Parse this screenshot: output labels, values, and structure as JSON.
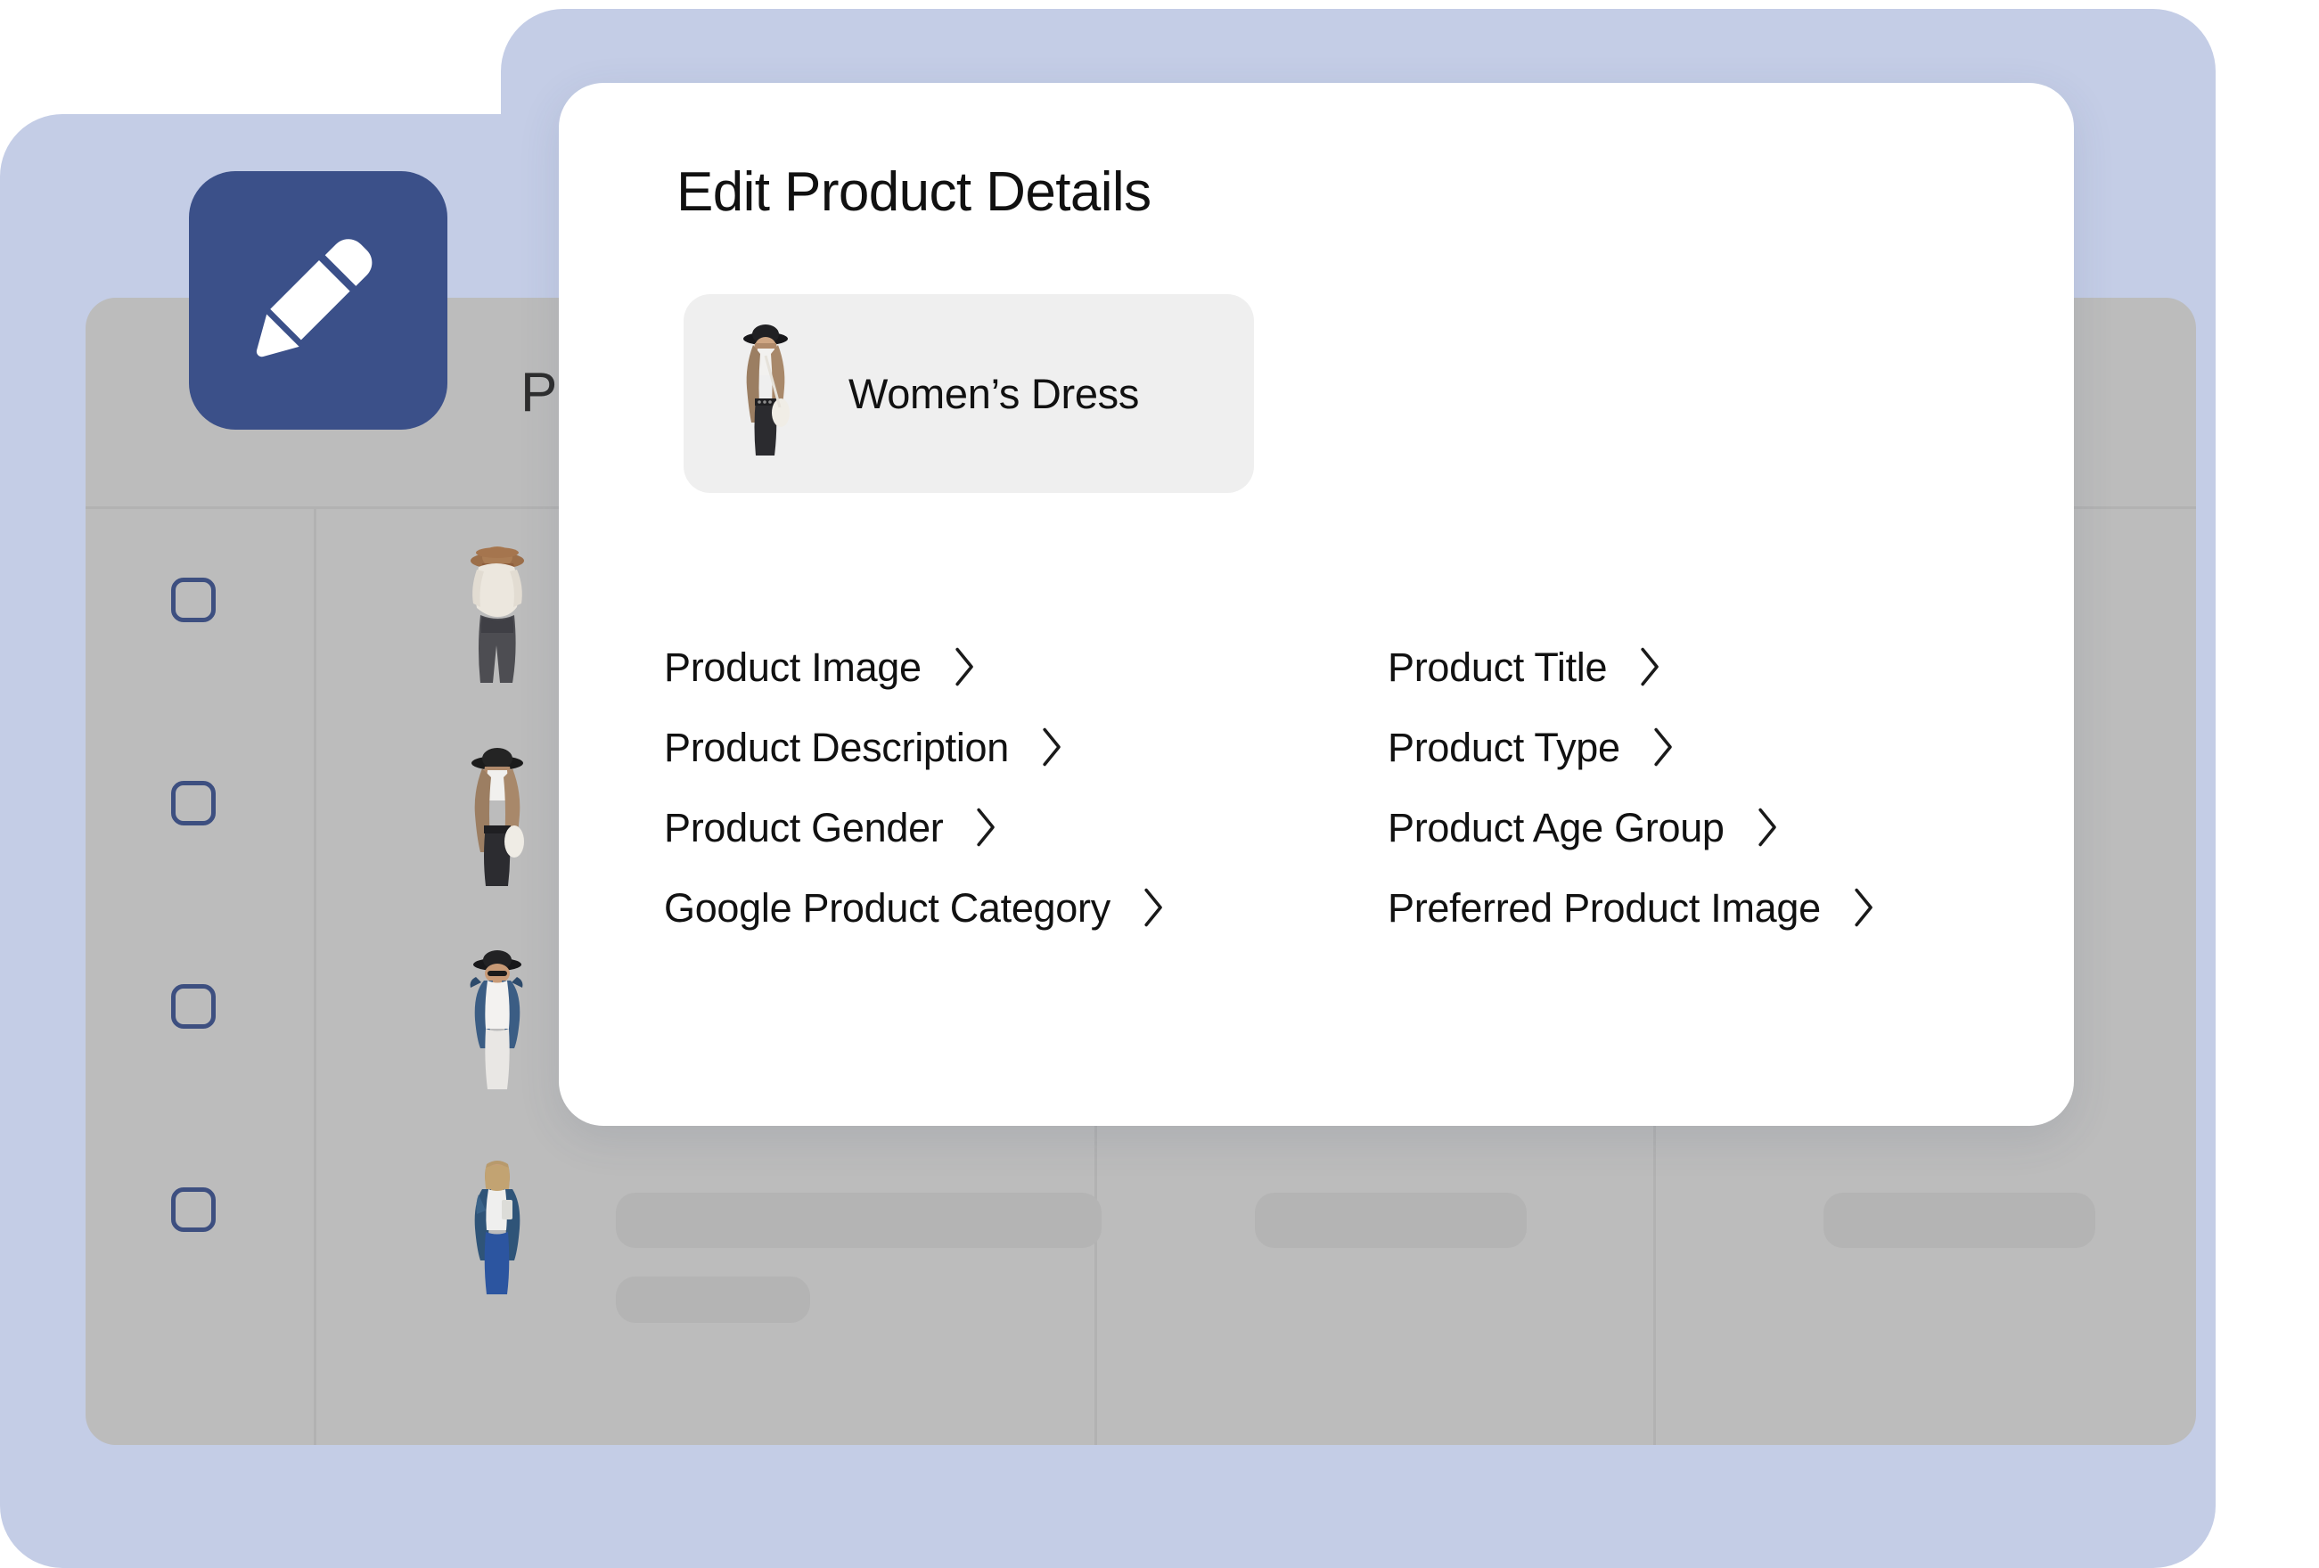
{
  "background": {
    "table_header_label": "P",
    "rows": [
      {
        "checkbox_checked": false
      },
      {
        "checkbox_checked": false
      },
      {
        "checkbox_checked": false
      },
      {
        "checkbox_checked": false
      }
    ]
  },
  "edit_badge": {
    "icon": "pencil-icon"
  },
  "modal": {
    "title": "Edit Product Details",
    "product": {
      "name": "Women’s Dress",
      "thumbnail": "women-dress-thumbnail"
    },
    "fields": [
      {
        "label": "Product Image",
        "chevron": "chevron-right-icon"
      },
      {
        "label": "Product Title",
        "chevron": "chevron-right-icon"
      },
      {
        "label": "Product Description",
        "chevron": "chevron-right-icon"
      },
      {
        "label": "Product Type",
        "chevron": "chevron-right-icon"
      },
      {
        "label": "Product Gender",
        "chevron": "chevron-right-icon"
      },
      {
        "label": "Product Age Group",
        "chevron": "chevron-right-icon"
      },
      {
        "label": "Google Product Category",
        "chevron": "chevron-right-icon"
      },
      {
        "label": "Preferred Product Image",
        "chevron": "chevron-right-icon"
      }
    ]
  },
  "colors": {
    "shell_blue": "#c4cde6",
    "table_gray": "#bcbcbc",
    "skeleton_gray": "#b4b4b4",
    "badge_navy": "#3b5089",
    "checkbox_navy": "#3d4f80",
    "chip_gray": "#efefef",
    "modal_white": "#ffffff",
    "text_dark": "#111111"
  }
}
